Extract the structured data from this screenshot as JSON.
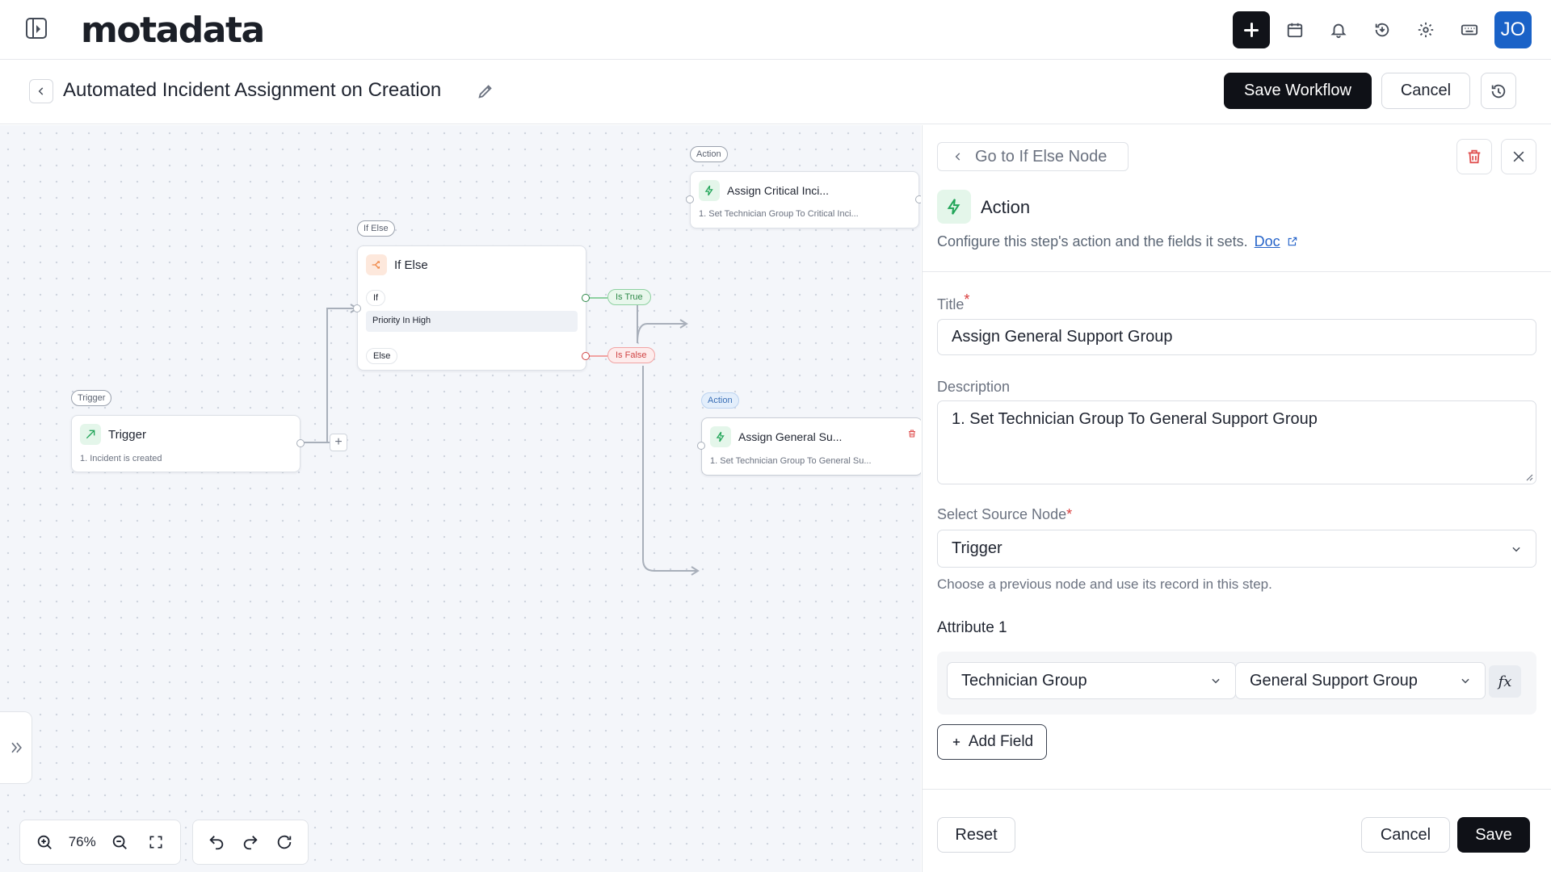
{
  "app": {
    "logo": "motadata",
    "avatar_initials": "JO"
  },
  "header": {
    "title": "Automated Incident Assignment on Creation",
    "save_label": "Save Workflow",
    "cancel_label": "Cancel"
  },
  "canvas": {
    "zoom": "76%",
    "trigger": {
      "tag": "Trigger",
      "title": "Trigger",
      "sub": "1. Incident is created"
    },
    "ifelse": {
      "tag": "If Else",
      "title": "If Else",
      "if_label": "If",
      "condition": "Priority In High",
      "else_label": "Else",
      "true_label": "Is True",
      "false_label": "Is False"
    },
    "action_critical": {
      "tag": "Action",
      "title": "Assign Critical Inci...",
      "sub": "1. Set Technician Group To Critical Inci..."
    },
    "action_general": {
      "tag": "Action",
      "title": "Assign General Su...",
      "sub": "1. Set Technician Group To General Su..."
    }
  },
  "panel": {
    "go_back": "Go to If Else Node",
    "type": "Action",
    "description": "Configure this step's action and the fields it sets.",
    "doc_link": "Doc",
    "title_label": "Title",
    "title_value": "Assign General Support Group",
    "desc_label": "Description",
    "desc_value": "1. Set Technician Group To General Support Group",
    "source_label": "Select Source Node",
    "source_value": "Trigger",
    "source_hint": "Choose a previous node and use its record in this step.",
    "attr_title": "Attribute 1",
    "attr_field": "Technician Group",
    "attr_value": "General Support Group",
    "fx_label": "fx",
    "add_field": "Add Field",
    "reset": "Reset",
    "cancel": "Cancel",
    "save": "Save"
  },
  "colors": {
    "primary_dark": "#0f1117",
    "avatar": "#1a62c7",
    "true_green": "#2f8a4a",
    "false_red": "#d04545",
    "action_green": "#22a559",
    "ifelse_orange": "#f08a4b"
  }
}
